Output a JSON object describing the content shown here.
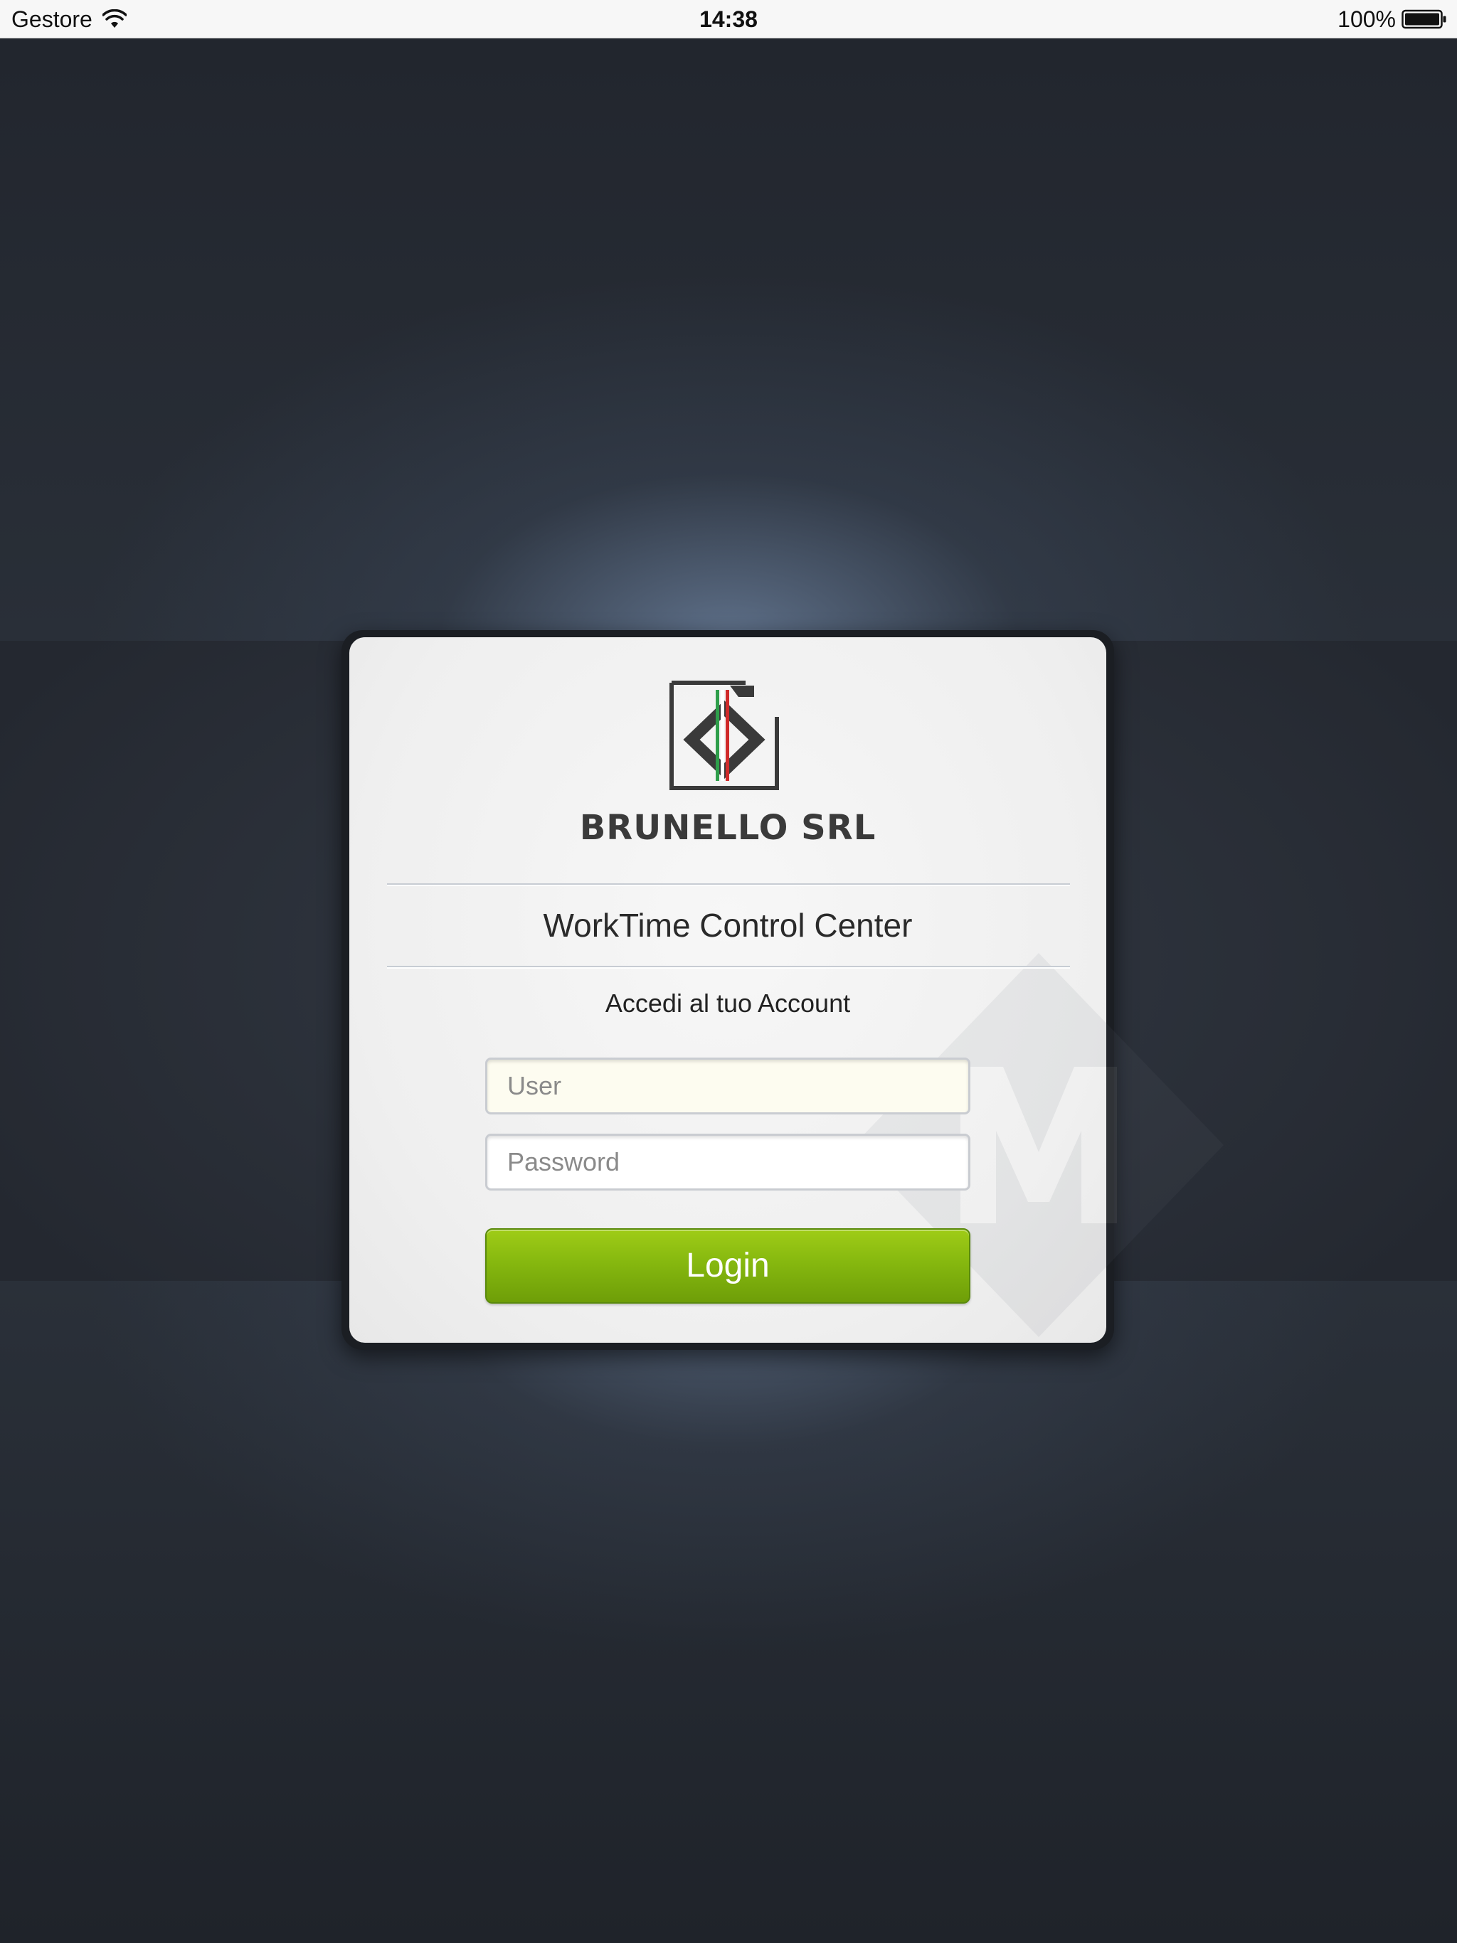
{
  "status_bar": {
    "carrier": "Gestore",
    "time": "14:38",
    "battery": "100%"
  },
  "login_card": {
    "company_name": "BRUNELLO SRL",
    "app_title": "WorkTime Control Center",
    "subtitle": "Accedi al tuo Account",
    "user_field": {
      "value": "",
      "placeholder": "User"
    },
    "password_field": {
      "value": "",
      "placeholder": "Password"
    },
    "login_button": "Login"
  },
  "icons": {
    "wifi": "wifi-icon",
    "battery": "battery-icon",
    "logo": "brunello-logo-icon",
    "watermark": "watermark-m-icon"
  },
  "colors": {
    "login_button": "#86b80f",
    "user_field_background": "#fdfcf0",
    "logo_green": "#2e9e4a",
    "logo_red": "#d02a2a"
  }
}
